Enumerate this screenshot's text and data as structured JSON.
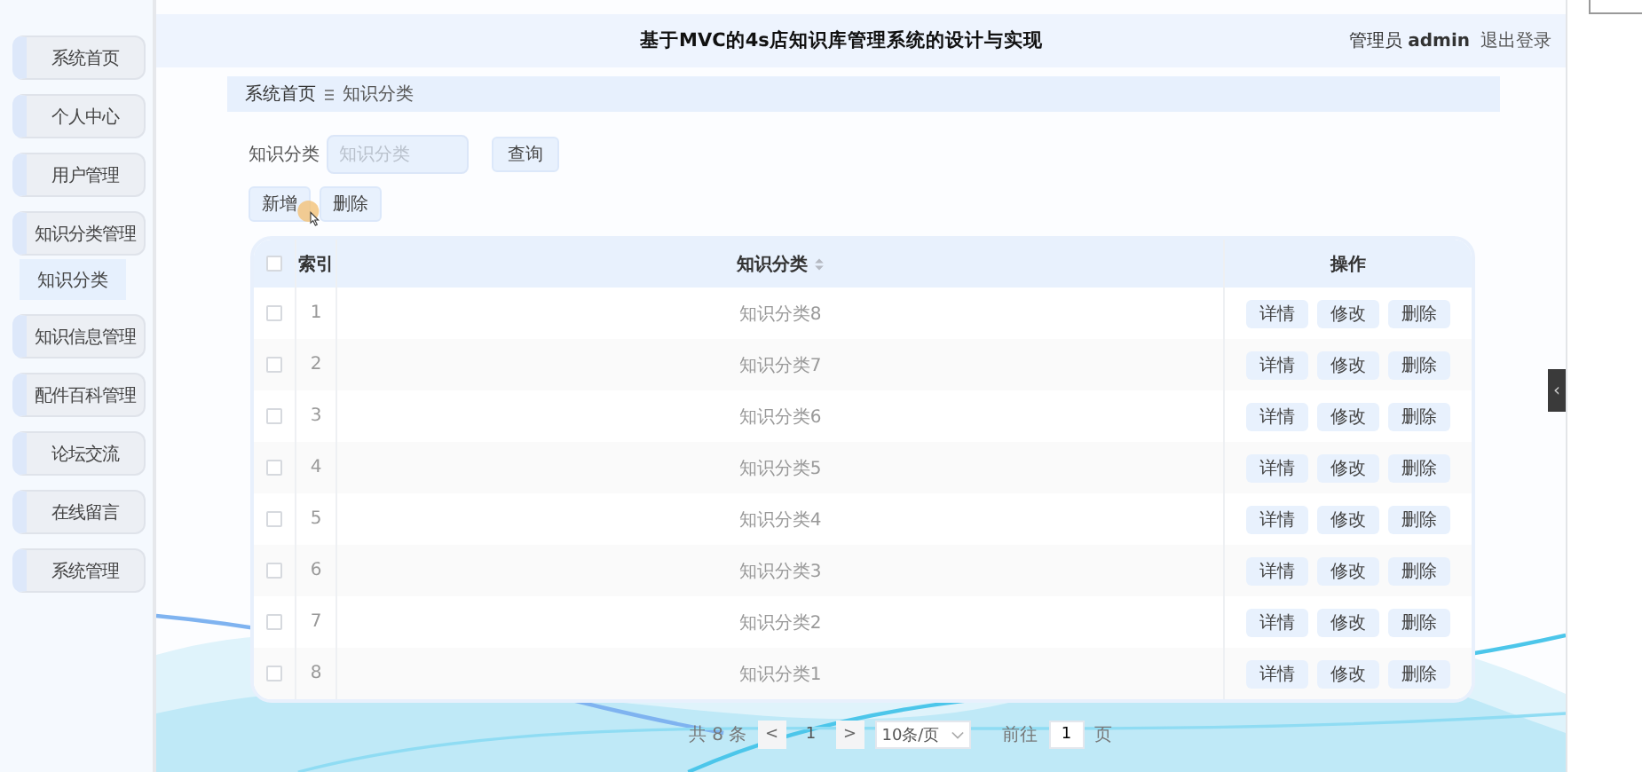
{
  "header": {
    "title": "基于MVC的4s店知识库管理系统的设计与实现",
    "user_role": "管理员",
    "user_name": "admin",
    "logout": "退出登录"
  },
  "sidebar": {
    "items": [
      {
        "label": "系统首页"
      },
      {
        "label": "个人中心"
      },
      {
        "label": "用户管理"
      },
      {
        "label": "知识分类管理",
        "children": [
          {
            "label": "知识分类",
            "selected": true
          }
        ]
      },
      {
        "label": "知识信息管理"
      },
      {
        "label": "配件百科管理"
      },
      {
        "label": "论坛交流"
      },
      {
        "label": "在线留言"
      },
      {
        "label": "系统管理"
      }
    ]
  },
  "breadcrumb": [
    "系统首页",
    "知识分类"
  ],
  "search": {
    "label": "知识分类",
    "placeholder": "知识分类",
    "button": "查询"
  },
  "actions": [
    "新增",
    "删除"
  ],
  "table": {
    "select_all_checked": false,
    "columns": [
      {
        "label": "索引",
        "sortable": false
      },
      {
        "label": "知识分类",
        "sortable": true
      },
      {
        "label": "操作",
        "sortable": false
      }
    ],
    "rows": [
      {
        "index": "1",
        "name": "知识分类8",
        "checked": false,
        "actions": [
          "详情",
          "修改",
          "删除"
        ]
      },
      {
        "index": "2",
        "name": "知识分类7",
        "checked": false,
        "actions": [
          "详情",
          "修改",
          "删除"
        ]
      },
      {
        "index": "3",
        "name": "知识分类6",
        "checked": false,
        "actions": [
          "详情",
          "修改",
          "删除"
        ]
      },
      {
        "index": "4",
        "name": "知识分类5",
        "checked": false,
        "actions": [
          "详情",
          "修改",
          "删除"
        ]
      },
      {
        "index": "5",
        "name": "知识分类4",
        "checked": false,
        "actions": [
          "详情",
          "修改",
          "删除"
        ]
      },
      {
        "index": "6",
        "name": "知识分类3",
        "checked": false,
        "actions": [
          "详情",
          "修改",
          "删除"
        ]
      },
      {
        "index": "7",
        "name": "知识分类2",
        "checked": false,
        "actions": [
          "详情",
          "修改",
          "删除"
        ]
      },
      {
        "index": "8",
        "name": "知识分类1",
        "checked": false,
        "actions": [
          "详情",
          "修改",
          "删除"
        ]
      }
    ]
  },
  "pagination": {
    "total": "共 8 条",
    "prev": "<",
    "page": "1",
    "next": ">",
    "page_size": "10条/页",
    "goto_label": "前往",
    "goto_value": "1",
    "goto_suffix": "页"
  },
  "collapse_handle": "‹"
}
